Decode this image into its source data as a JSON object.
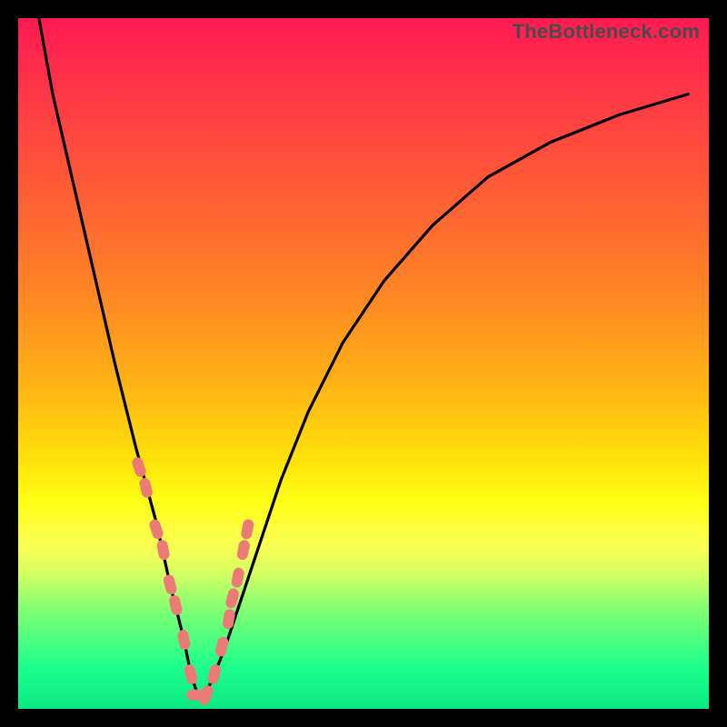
{
  "watermark": "TheBottleneck.com",
  "chart_data": {
    "type": "line",
    "title": "",
    "xlabel": "",
    "ylabel": "",
    "xlim": [
      0,
      100
    ],
    "ylim": [
      0,
      100
    ],
    "series": [
      {
        "name": "bottleneck-curve",
        "x": [
          3,
          5,
          8,
          11,
          14,
          17,
          20,
          22,
          24,
          25,
          26,
          27,
          28,
          30,
          32,
          35,
          38,
          42,
          47,
          53,
          60,
          68,
          77,
          87,
          97
        ],
        "values": [
          100,
          89,
          76,
          63,
          50,
          38,
          27,
          18,
          10,
          5,
          2,
          2,
          4,
          9,
          15,
          24,
          33,
          43,
          53,
          62,
          70,
          77,
          82,
          86,
          89
        ]
      }
    ],
    "markers": {
      "name": "salmon-dashes",
      "x": [
        17.5,
        18.5,
        20.0,
        21.0,
        22.0,
        22.8,
        24.0,
        25.0,
        25.8,
        27.2,
        28.4,
        29.5,
        30.5,
        31.0,
        31.8,
        32.6,
        33.2
      ],
      "values": [
        35,
        32,
        26,
        23,
        18,
        15,
        10,
        5,
        2,
        2,
        5,
        9,
        13,
        16,
        19,
        23,
        26
      ],
      "color": "#ec7b78"
    },
    "gradient_stops": [
      {
        "pos": 0,
        "color": "#ff1a52"
      },
      {
        "pos": 50,
        "color": "#ffb714"
      },
      {
        "pos": 72,
        "color": "#ffff30"
      },
      {
        "pos": 100,
        "color": "#0ce884"
      }
    ]
  }
}
